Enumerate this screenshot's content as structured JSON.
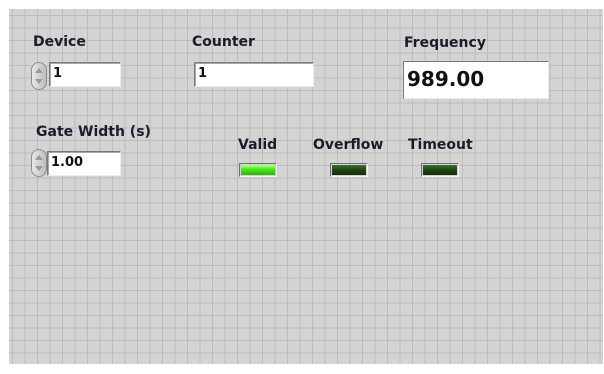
{
  "device": {
    "label": "Device",
    "value": "1"
  },
  "counter": {
    "label": "Counter",
    "value": "1"
  },
  "frequency": {
    "label": "Frequency",
    "value": "989.00"
  },
  "gate_width": {
    "label": "Gate Width (s)",
    "value": "1.00"
  },
  "indicators": {
    "valid": {
      "label": "Valid",
      "on": true
    },
    "overflow": {
      "label": "Overflow",
      "on": false
    },
    "timeout": {
      "label": "Timeout",
      "on": false
    }
  },
  "colors": {
    "led_on": "#44e61c",
    "led_off": "#1e4412",
    "panel_background": "#d4d4d4",
    "grid_line": "#bcbcbc"
  },
  "icons": {
    "spinner_up": "up-arrow-icon",
    "spinner_down": "down-arrow-icon"
  }
}
